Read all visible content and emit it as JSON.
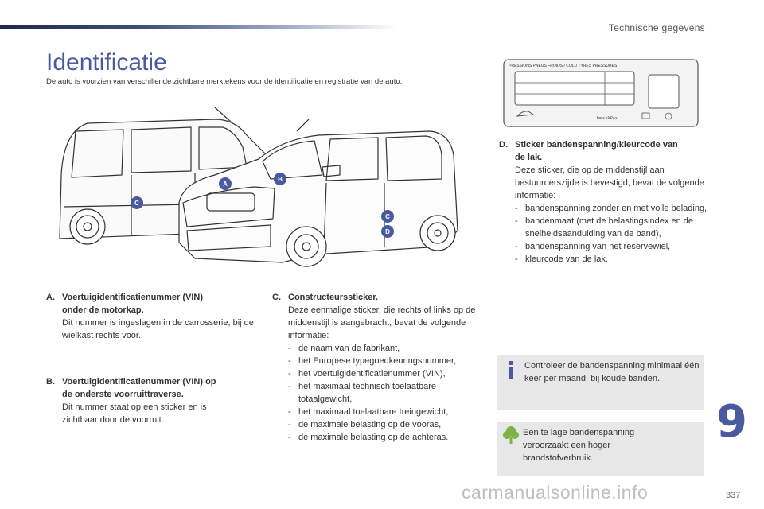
{
  "header": {
    "section_title": "Technische gegevens"
  },
  "page": {
    "title": "Identificatie",
    "subtitle": "De auto is voorzien van verschillende zichtbare merktekens voor de identificatie en registratie van de auto.",
    "chapter_number": "9",
    "page_number": "337",
    "watermark": "carmanualsonline.info"
  },
  "markers": {
    "a": "A",
    "b": "B",
    "c": "C",
    "d": "D"
  },
  "sticker": {
    "header_text": "PRESSIONS PNEUS FROIDS / COLD TYRES PRESSURES",
    "bottom_text": "bars  <kPa>"
  },
  "items": {
    "a": {
      "letter": "A.",
      "heading_line1": "Voertuigidentificatienummer (VIN)",
      "heading_line2": "onder de motorkap.",
      "text": "Dit nummer is ingeslagen in de carrosserie, bij de wielkast rechts voor."
    },
    "b": {
      "letter": "B.",
      "heading_line1": "Voertuigidentificatienummer (VIN) op",
      "heading_line2": "de onderste voorruittraverse.",
      "text": "Dit nummer staat op een sticker en is zichtbaar door de voorruit."
    },
    "c": {
      "letter": "C.",
      "heading": "Constructeurssticker.",
      "text": "Deze eenmalige sticker, die rechts of links op de middenstijl is aangebracht, bevat de volgende informatie:",
      "list": [
        "de naam van de fabrikant,",
        "het Europese typegoedkeuringsnummer,",
        "het voertuigidentificatienummer (VIN),",
        "het maximaal technisch toelaatbare totaalgewicht,",
        "het maximaal toelaatbare treingewicht,",
        "de maximale belasting op de vooras,",
        "de maximale belasting op de achteras."
      ]
    },
    "d": {
      "letter": "D.",
      "heading_line1": "Sticker bandenspanning/kleurcode van",
      "heading_line2": "de lak.",
      "text": "Deze sticker, die op de middenstijl aan bestuurderszijde is bevestigd, bevat de volgende informatie:",
      "list": [
        "bandenspanning zonder en met volle belading,",
        "bandenmaat (met de belastingsindex en de snelheidsaanduiding van de band),",
        "bandenspanning van het reservewiel,",
        "kleurcode van de lak."
      ]
    }
  },
  "notes": {
    "info": "Controleer de bandenspanning minimaal één keer per maand, bij koude banden.",
    "eco": "Een te lage bandenspanning veroorzaakt een hoger brandstofverbruik."
  },
  "colors": {
    "accent": "#4a5aa0",
    "note_bg": "#e7e7e7",
    "eco_green": "#7cb342"
  }
}
